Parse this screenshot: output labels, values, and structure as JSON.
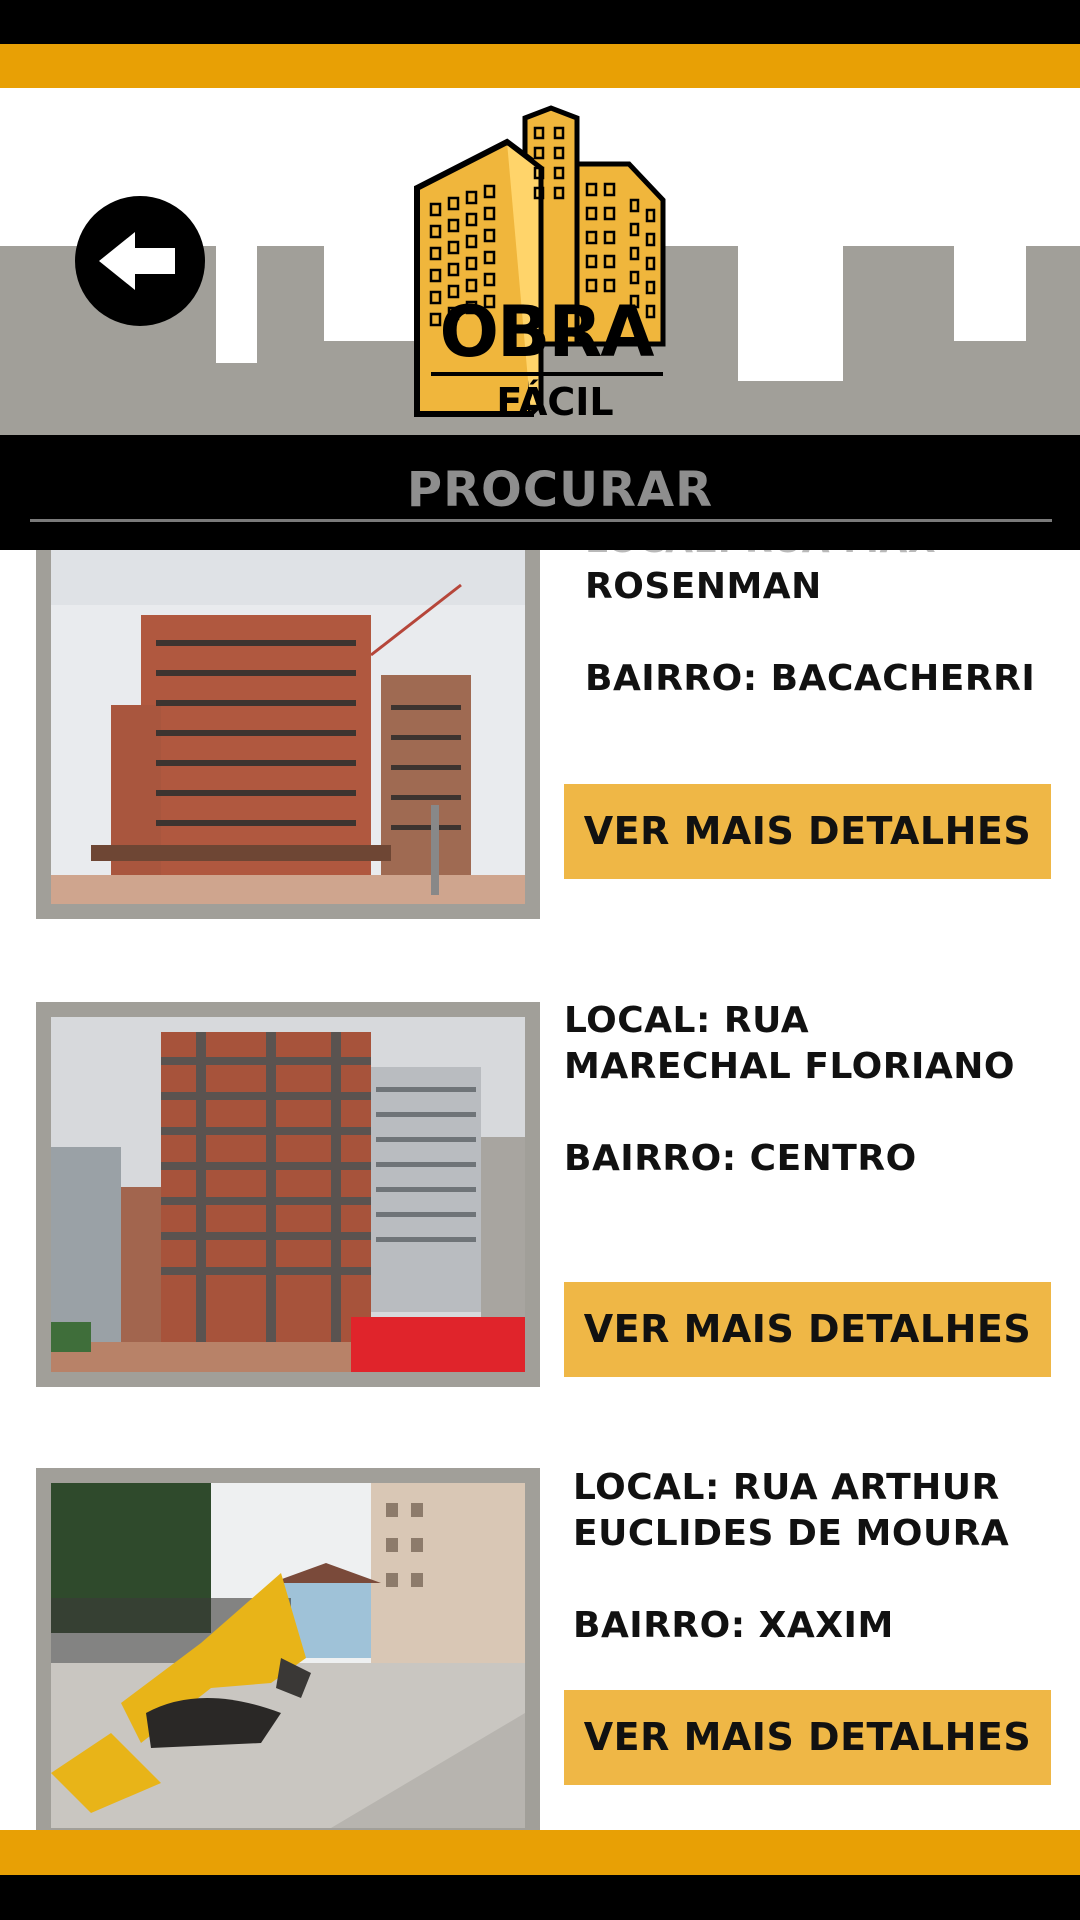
{
  "app": {
    "logo_main": "OBRA",
    "logo_sub": "FÁCIL"
  },
  "search": {
    "label": "PROCURAR"
  },
  "colors": {
    "brand_orange": "#e8a005",
    "button_yellow": "#efb746",
    "header_gray": "#a19f99"
  },
  "icons": {
    "back": "arrow-left-icon"
  },
  "listings": [
    {
      "local_line1": "LOCAL: RUA MAX",
      "local_line2": "ROSENMAN",
      "bairro": "BAIRRO: BACACHERRI",
      "button": "VER MAIS DETALHES"
    },
    {
      "local_line1": "LOCAL: RUA",
      "local_line2": "MARECHAL FLORIANO",
      "bairro": "BAIRRO: CENTRO",
      "button": "VER MAIS DETALHES"
    },
    {
      "local_line1": "LOCAL: RUA ARTHUR",
      "local_line2": "EUCLIDES DE MOURA",
      "bairro": "BAIRRO: XAXIM",
      "button": "VER MAIS DETALHES"
    }
  ]
}
